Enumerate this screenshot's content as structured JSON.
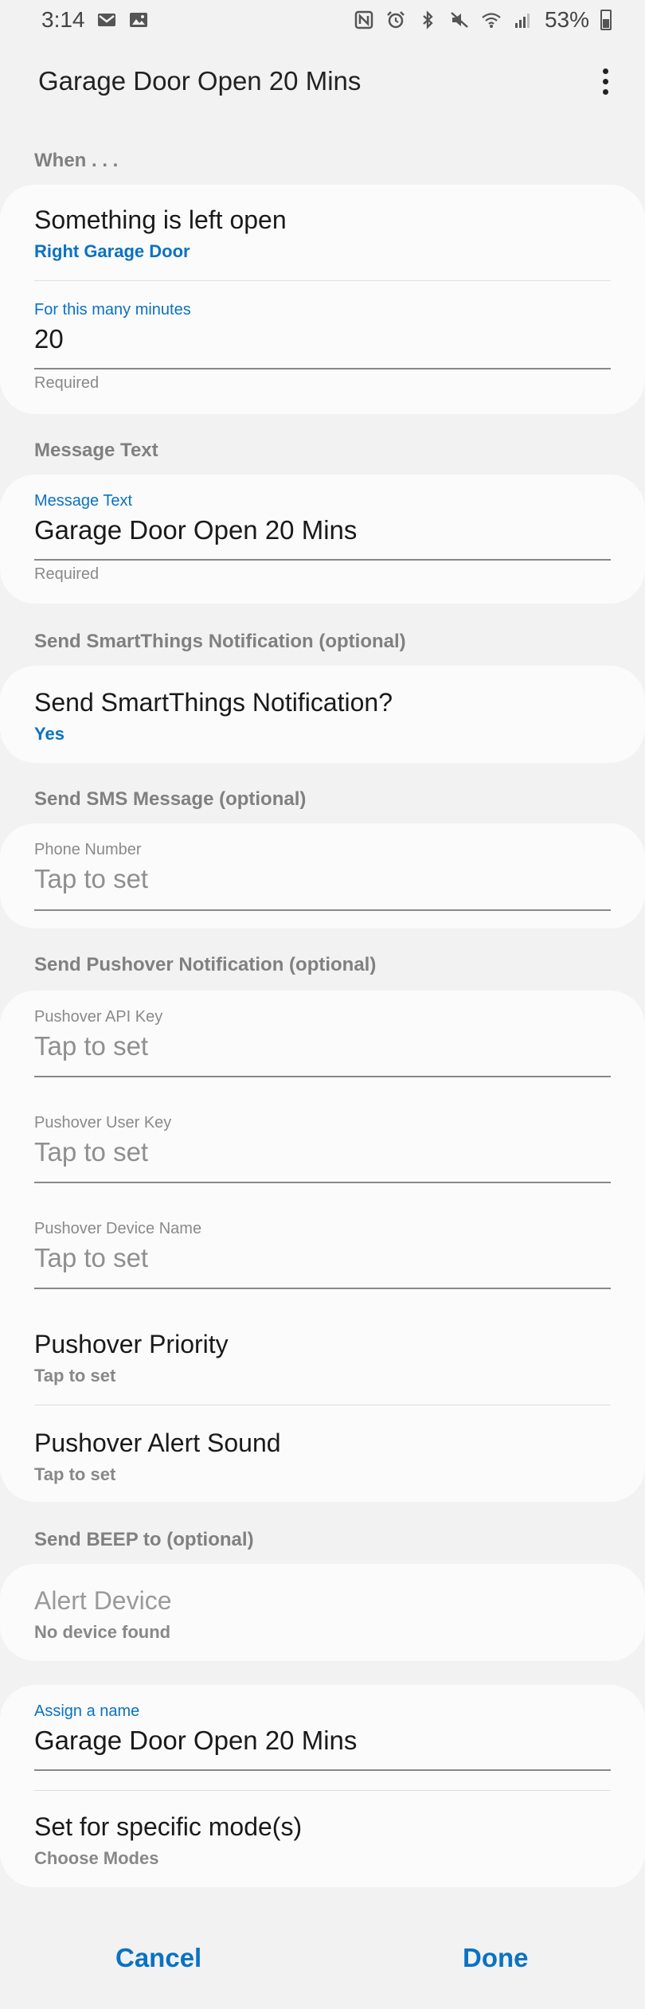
{
  "status_bar": {
    "time": "3:14",
    "battery": "53%",
    "left_icons": [
      "gmail-icon",
      "gallery-icon"
    ],
    "right_icons": [
      "nfc-icon",
      "alarm-icon",
      "bluetooth-icon",
      "mute-icon",
      "wifi-icon",
      "signal-icon",
      "battery-icon"
    ]
  },
  "app_bar": {
    "title": "Garage Door Open 20 Mins"
  },
  "sections": {
    "when": "When . . .",
    "message_text": "Message Text",
    "smartthings": "Send SmartThings Notification (optional)",
    "sms": "Send SMS Message (optional)",
    "pushover": "Send Pushover Notification (optional)",
    "beep": "Send BEEP to (optional)"
  },
  "when_card": {
    "trigger_title": "Something is left open",
    "trigger_value": "Right Garage Door",
    "minutes_label": "For this many minutes",
    "minutes_value": "20",
    "minutes_helper": "Required"
  },
  "message_card": {
    "label": "Message Text",
    "value": "Garage Door Open 20 Mins",
    "helper": "Required"
  },
  "smartthings_card": {
    "title": "Send SmartThings Notification?",
    "value": "Yes"
  },
  "sms_card": {
    "label": "Phone Number",
    "placeholder": "Tap to set"
  },
  "pushover_card": {
    "api_key_label": "Pushover API Key",
    "api_key_placeholder": "Tap to set",
    "user_key_label": "Pushover User Key",
    "user_key_placeholder": "Tap to set",
    "device_label": "Pushover Device Name",
    "device_placeholder": "Tap to set",
    "priority_title": "Pushover Priority",
    "priority_value": "Tap to set",
    "sound_title": "Pushover Alert Sound",
    "sound_value": "Tap to set"
  },
  "beep_card": {
    "title": "Alert Device",
    "value": "No device found"
  },
  "name_card": {
    "label": "Assign a name",
    "value": "Garage Door Open 20 Mins",
    "modes_title": "Set for specific mode(s)",
    "modes_value": "Choose Modes"
  },
  "footer": {
    "cancel": "Cancel",
    "done": "Done"
  },
  "colors": {
    "accent": "#0a72c2",
    "background": "#f2f2f2",
    "card": "#fbfbfb"
  }
}
